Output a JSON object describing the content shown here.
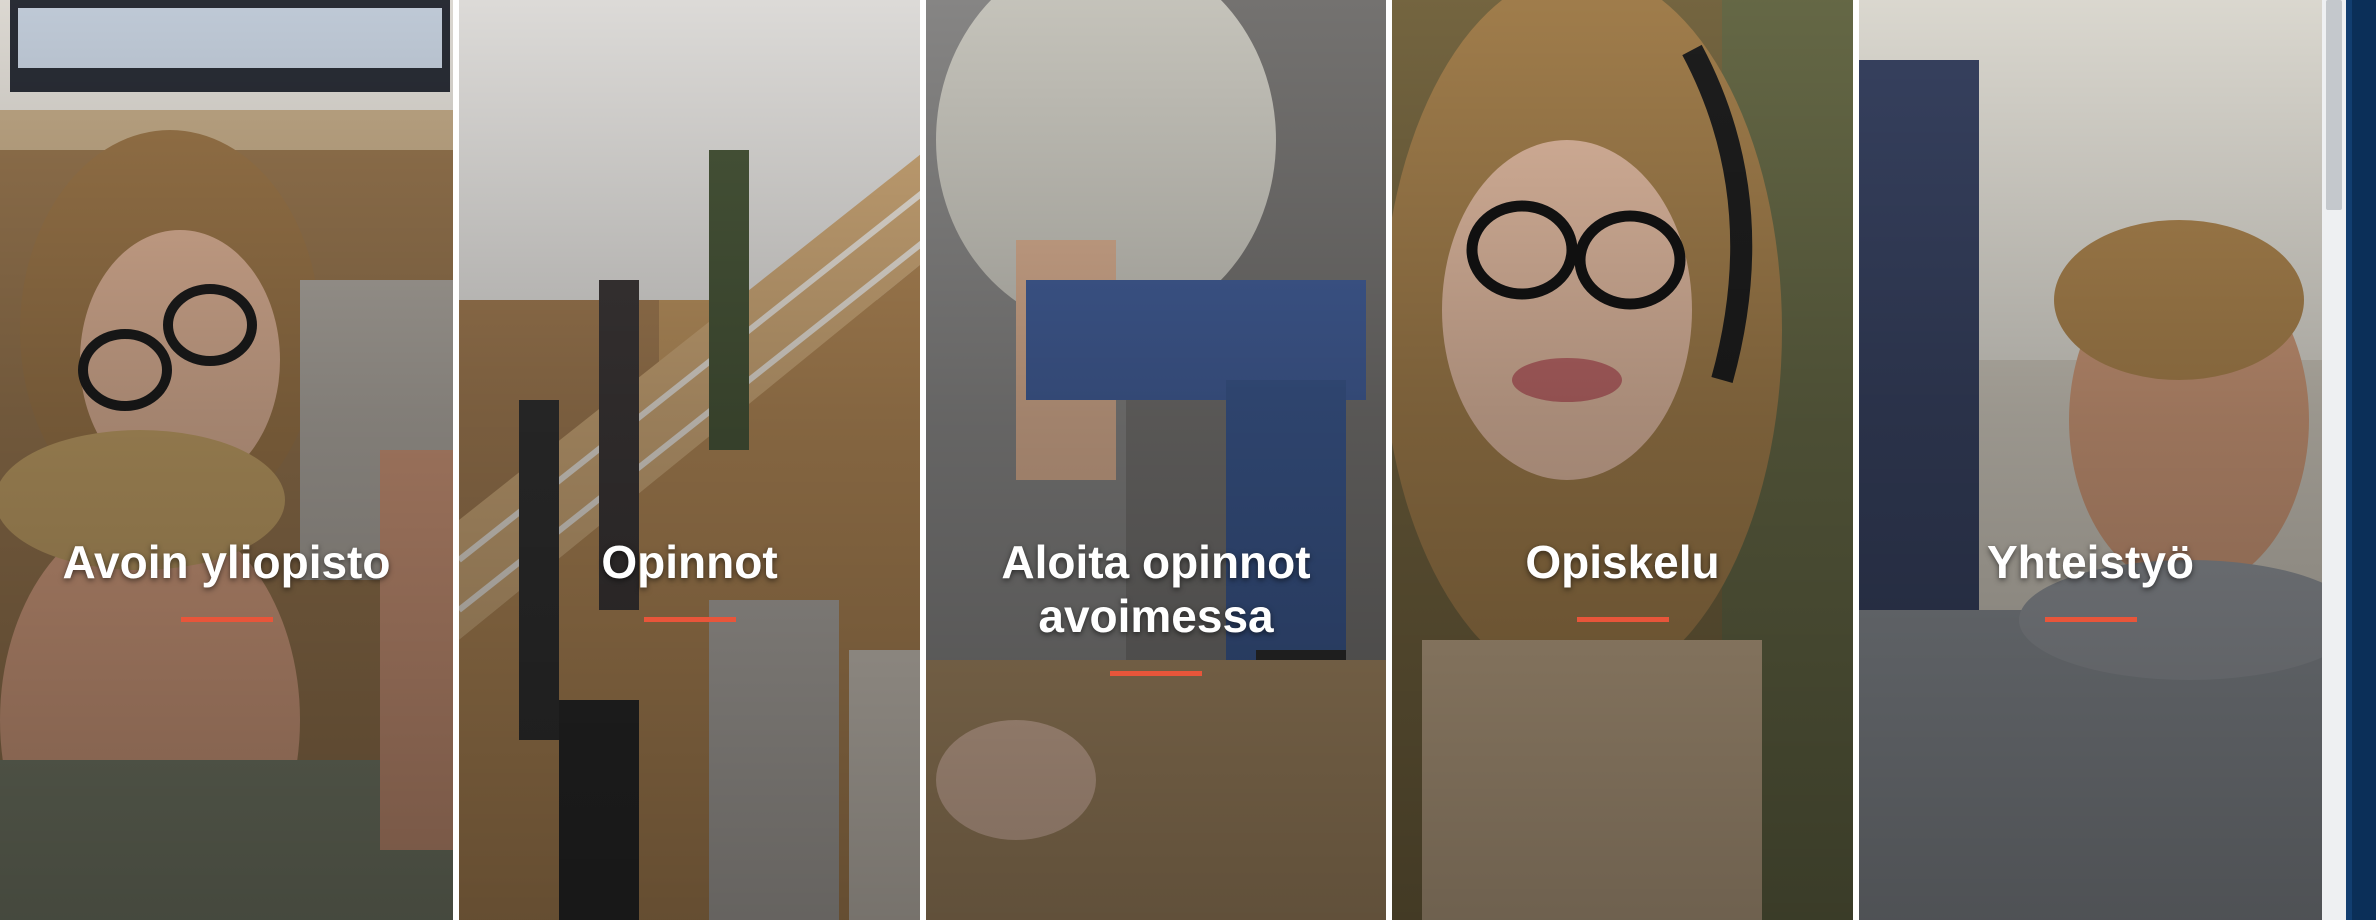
{
  "tiles": [
    {
      "label": "Avoin yliopisto",
      "photo": "portrait-woman-with-glasses-and-man",
      "colors": [
        "#b08a5a",
        "#6f5036",
        "#d9c2a2"
      ]
    },
    {
      "label": "Opinnot",
      "photo": "students-on-wooden-stairs",
      "colors": [
        "#c89a63",
        "#8a6a44",
        "#e6d6c0"
      ]
    },
    {
      "label": "Aloita opinnot avoimessa",
      "photo": "student-sitting-jeans",
      "colors": [
        "#7d776c",
        "#3d4d6e",
        "#a9a294"
      ]
    },
    {
      "label": "Opiskelu",
      "photo": "smiling-woman-with-headphones",
      "colors": [
        "#7c6a3f",
        "#c9a772",
        "#5b5a3c"
      ]
    },
    {
      "label": "Yhteistyö",
      "photo": "smiling-man-blurred",
      "colors": [
        "#cfc7b8",
        "#8c8f95",
        "#d5a47e"
      ]
    }
  ],
  "accent_color": "#e8553a",
  "caption_color": "#ffffff"
}
